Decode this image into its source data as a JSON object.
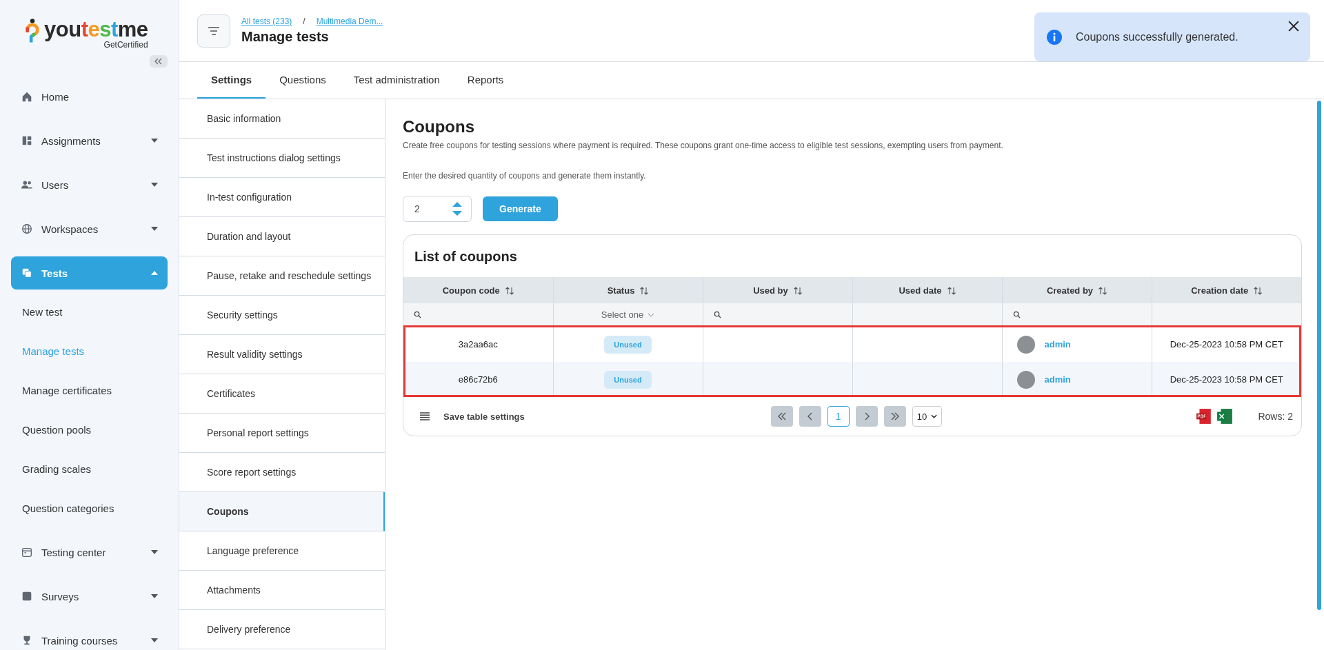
{
  "logo": {
    "segments": [
      {
        "text": "you",
        "color": "#2b2b2b"
      },
      {
        "text": "t",
        "color": "#e5462f"
      },
      {
        "text": "e",
        "color": "#f59a22"
      },
      {
        "text": "s",
        "color": "#4db848"
      },
      {
        "text": "t",
        "color": "#2ea3dc"
      },
      {
        "text": "me",
        "color": "#2b2b2b"
      }
    ],
    "tagline": "GetCertified"
  },
  "sidebar": {
    "items": [
      {
        "label": "Home",
        "kind": "link",
        "selected": false
      },
      {
        "label": "Assignments",
        "kind": "group",
        "expanded": false,
        "selected": false
      },
      {
        "label": "Users",
        "kind": "group",
        "expanded": false,
        "selected": false
      },
      {
        "label": "Workspaces",
        "kind": "group",
        "expanded": false,
        "selected": false
      },
      {
        "label": "Tests",
        "kind": "group",
        "expanded": true,
        "selected": true,
        "children": [
          {
            "label": "New test",
            "selected": false
          },
          {
            "label": "Manage tests",
            "selected": true
          },
          {
            "label": "Manage certificates",
            "selected": false
          },
          {
            "label": "Question pools",
            "selected": false
          },
          {
            "label": "Grading scales",
            "selected": false
          },
          {
            "label": "Question categories",
            "selected": false
          }
        ]
      },
      {
        "label": "Testing center",
        "kind": "group",
        "expanded": false,
        "selected": false
      },
      {
        "label": "Surveys",
        "kind": "group",
        "expanded": false,
        "selected": false
      },
      {
        "label": "Training courses",
        "kind": "group",
        "expanded": false,
        "selected": false
      }
    ]
  },
  "header": {
    "breadcrumbs": [
      "All tests (233)",
      "Multimedia Dem..."
    ],
    "separator": "/",
    "title": "Manage tests"
  },
  "toast": {
    "message": "Coupons successfully generated."
  },
  "tabs": [
    {
      "label": "Settings",
      "selected": true
    },
    {
      "label": "Questions",
      "selected": false
    },
    {
      "label": "Test administration",
      "selected": false
    },
    {
      "label": "Reports",
      "selected": false
    }
  ],
  "settings_menu": [
    {
      "label": "Basic information",
      "selected": false
    },
    {
      "label": "Test instructions dialog settings",
      "selected": false
    },
    {
      "label": "In-test configuration",
      "selected": false
    },
    {
      "label": "Duration and layout",
      "selected": false
    },
    {
      "label": "Pause, retake and reschedule settings",
      "selected": false
    },
    {
      "label": "Security settings",
      "selected": false
    },
    {
      "label": "Result validity settings",
      "selected": false
    },
    {
      "label": "Certificates",
      "selected": false
    },
    {
      "label": "Personal report settings",
      "selected": false
    },
    {
      "label": "Score report settings",
      "selected": false
    },
    {
      "label": "Coupons",
      "selected": true
    },
    {
      "label": "Language preference",
      "selected": false
    },
    {
      "label": "Attachments",
      "selected": false
    },
    {
      "label": "Delivery preference",
      "selected": false
    }
  ],
  "coupons": {
    "title": "Coupons",
    "description": "Create free coupons for testing sessions where payment is required. These coupons grant one-time access to eligible test sessions, exempting users from payment.",
    "instruction": "Enter the desired quantity of coupons and generate them instantly.",
    "quantity": "2",
    "generate_label": "Generate"
  },
  "table": {
    "title": "List of coupons",
    "columns": [
      {
        "label": "Coupon code",
        "kind": "search"
      },
      {
        "label": "Status",
        "kind": "select",
        "placeholder": "Select one"
      },
      {
        "label": "Used by",
        "kind": "search"
      },
      {
        "label": "Used date",
        "kind": "plain"
      },
      {
        "label": "Created by",
        "kind": "search"
      },
      {
        "label": "Creation date",
        "kind": "plain"
      }
    ],
    "rows": [
      {
        "code": "3a2aa6ac",
        "status": "Unused",
        "created_by": "admin",
        "creation_date": "Dec-25-2023 10:58 PM CET"
      },
      {
        "code": "e86c72b6",
        "status": "Unused",
        "created_by": "admin",
        "creation_date": "Dec-25-2023 10:58 PM CET"
      }
    ],
    "highlighted": true,
    "save_settings": "Save table settings",
    "page": "1",
    "page_size": "10",
    "rows_count": "Rows: 2"
  }
}
